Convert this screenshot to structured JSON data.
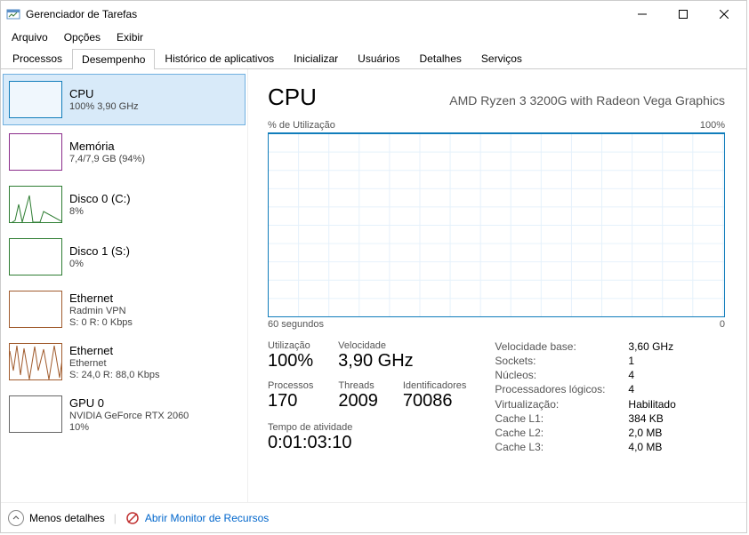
{
  "window": {
    "title": "Gerenciador de Tarefas"
  },
  "menu": {
    "file": "Arquivo",
    "options": "Opções",
    "view": "Exibir"
  },
  "tabs": {
    "processes": "Processos",
    "performance": "Desempenho",
    "appHistory": "Histórico de aplicativos",
    "startup": "Inicializar",
    "users": "Usuários",
    "details": "Detalhes",
    "services": "Serviços"
  },
  "sidebar": [
    {
      "title": "CPU",
      "sub1": "100%  3,90 GHz",
      "sub2": "",
      "kind": "cpu",
      "selected": true
    },
    {
      "title": "Memória",
      "sub1": "7,4/7,9 GB (94%)",
      "sub2": "",
      "kind": "mem",
      "selected": false
    },
    {
      "title": "Disco 0 (C:)",
      "sub1": "8%",
      "sub2": "",
      "kind": "disk",
      "selected": false
    },
    {
      "title": "Disco 1 (S:)",
      "sub1": "0%",
      "sub2": "",
      "kind": "disk",
      "selected": false
    },
    {
      "title": "Ethernet",
      "sub1": "Radmin VPN",
      "sub2": "S: 0  R: 0 Kbps",
      "kind": "net",
      "selected": false
    },
    {
      "title": "Ethernet",
      "sub1": "Ethernet",
      "sub2": "S: 24,0  R: 88,0 Kbps",
      "kind": "net",
      "selected": false
    },
    {
      "title": "GPU 0",
      "sub1": "NVIDIA GeForce RTX 2060",
      "sub2": "10%",
      "kind": "gpu",
      "selected": false
    }
  ],
  "main": {
    "title": "CPU",
    "subtitle": "AMD Ryzen 3 3200G with Radeon Vega Graphics",
    "chartTopLeft": "% de Utilização",
    "chartTopRight": "100%",
    "chartBottomLeft": "60 segundos",
    "chartBottomRight": "0",
    "stats": {
      "utilLabel": "Utilização",
      "utilValue": "100%",
      "speedLabel": "Velocidade",
      "speedValue": "3,90 GHz",
      "procLabel": "Processos",
      "procValue": "170",
      "threadsLabel": "Threads",
      "threadsValue": "2009",
      "handlesLabel": "Identificadores",
      "handlesValue": "70086",
      "uptimeLabel": "Tempo de atividade",
      "uptimeValue": "0:01:03:10"
    },
    "right": {
      "baseSpeedLabel": "Velocidade base:",
      "baseSpeedValue": "3,60 GHz",
      "socketsLabel": "Sockets:",
      "socketsValue": "1",
      "coresLabel": "Núcleos:",
      "coresValue": "4",
      "logicalLabel": "Processadores lógicos:",
      "logicalValue": "4",
      "virtLabel": "Virtualização:",
      "virtValue": "Habilitado",
      "l1Label": "Cache L1:",
      "l1Value": "384 KB",
      "l2Label": "Cache L2:",
      "l2Value": "2,0 MB",
      "l3Label": "Cache L3:",
      "l3Value": "4,0 MB"
    }
  },
  "footer": {
    "fewer": "Menos detalhes",
    "resmon": "Abrir Monitor de Recursos"
  },
  "chart_data": {
    "type": "line",
    "title": "% de Utilização",
    "xlabel": "60 segundos",
    "ylabel": "",
    "x_range": [
      60,
      0
    ],
    "ylim": [
      0,
      100
    ],
    "series": [
      {
        "name": "CPU",
        "values": []
      }
    ],
    "note": "chart area is empty in screenshot (no plotted line visible)"
  }
}
